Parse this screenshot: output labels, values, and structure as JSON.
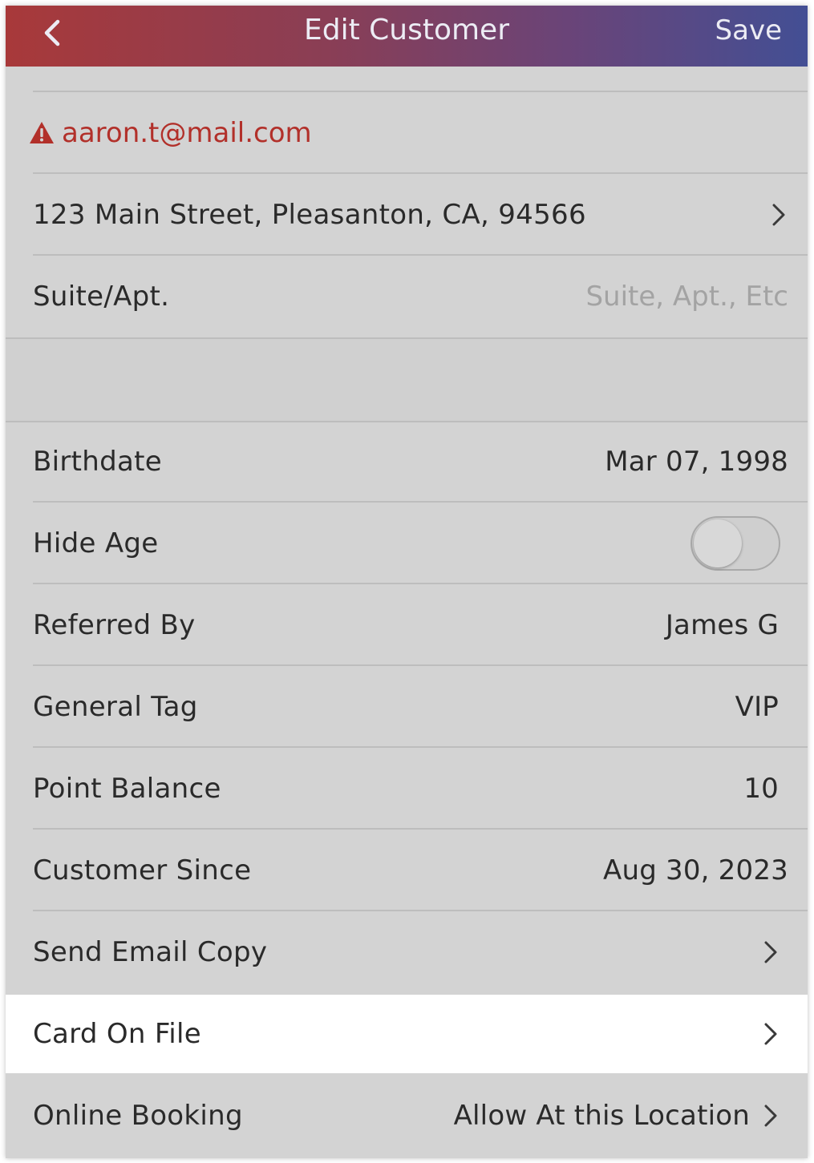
{
  "header": {
    "title": "Edit Customer",
    "save_label": "Save"
  },
  "contact": {
    "email": "aaron.t@mail.com",
    "email_warning": true,
    "address": "123 Main Street, Pleasanton, CA, 94566",
    "suite_label": "Suite/Apt.",
    "suite_placeholder": "Suite, Apt., Etc"
  },
  "details": {
    "birthdate_label": "Birthdate",
    "birthdate_value": "Mar 07, 1998",
    "hide_age_label": "Hide Age",
    "hide_age_on": false,
    "referred_by_label": "Referred By",
    "referred_by_value": "James G",
    "general_tag_label": "General Tag",
    "general_tag_value": "VIP",
    "point_balance_label": "Point Balance",
    "point_balance_value": "10",
    "customer_since_label": "Customer Since",
    "customer_since_value": "Aug 30, 2023",
    "send_email_copy_label": "Send Email Copy",
    "card_on_file_label": "Card On File",
    "online_booking_label": "Online Booking",
    "online_booking_value": "Allow At this Location"
  },
  "colors": {
    "header_gradient_start": "#a8393a",
    "header_gradient_end": "#434f94",
    "warning": "#b2302a",
    "background": "#d3d3d3",
    "highlight_row": "#ffffff"
  },
  "icons": {
    "back": "chevron-left-icon",
    "warning": "warning-triangle-icon",
    "disclosure": "chevron-right-icon"
  }
}
